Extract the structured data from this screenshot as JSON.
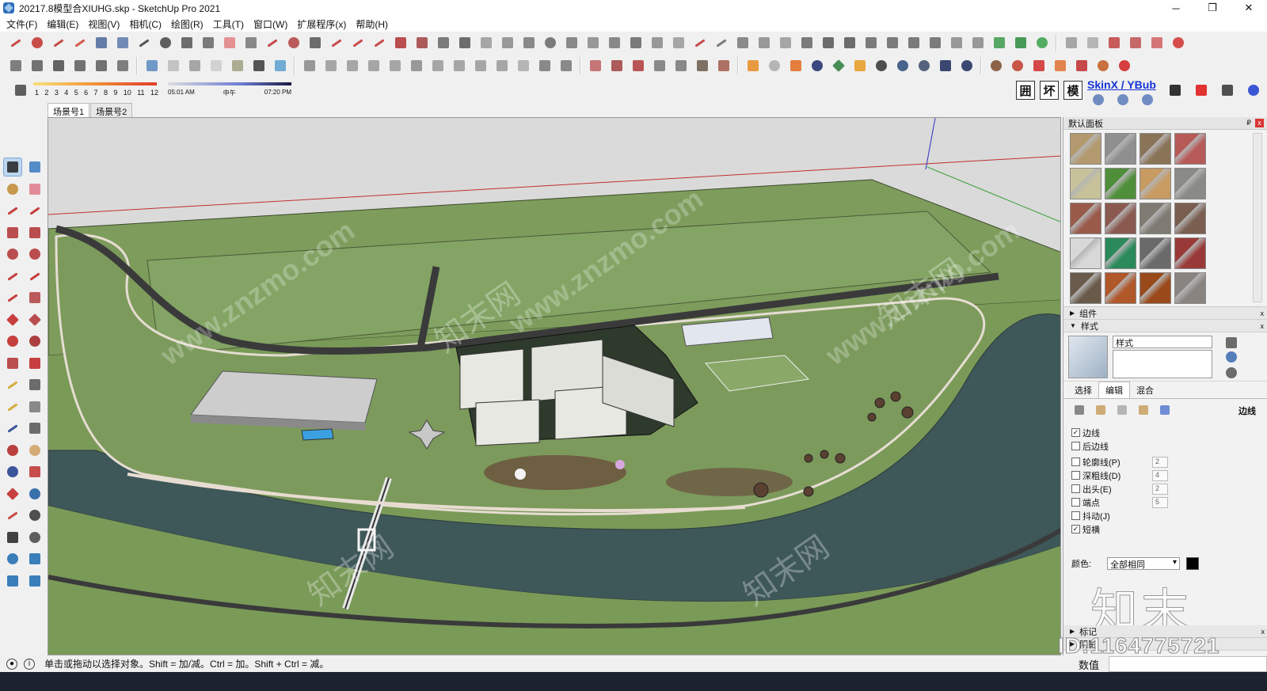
{
  "window": {
    "title": "20217.8模型合XIUHG.skp - SketchUp Pro 2021",
    "minimize": "─",
    "maximize": "❐",
    "close": "✕"
  },
  "menu": [
    "文件(F)",
    "编辑(E)",
    "视图(V)",
    "相机(C)",
    "绘图(R)",
    "工具(T)",
    "窗口(W)",
    "扩展程序(x)",
    "帮助(H)"
  ],
  "shadow_bar": {
    "months": [
      "1",
      "2",
      "3",
      "4",
      "5",
      "6",
      "7",
      "8",
      "9",
      "10",
      "11",
      "12"
    ],
    "time_start": "05:01 AM",
    "time_mid": "中午",
    "time_end": "07:20 PM"
  },
  "toolbar_right": {
    "btn1": "囲",
    "btn2": "坏",
    "btn3": "模",
    "skinx": "SkinX / YBub"
  },
  "scenes": [
    "场景号1",
    "场景号2"
  ],
  "viewport": {
    "watermark": "www.znzmo.com",
    "watermark_cn": "知末网"
  },
  "right_panel": {
    "tray_title": "默认面板",
    "pin": "₽",
    "close": "x",
    "section_components": "组件",
    "section_styles": "样式",
    "style_name": "样式",
    "tabs": [
      "选择",
      "编辑",
      "混合"
    ],
    "edit_label": "边线",
    "edge_options": [
      {
        "label": "边线",
        "checked": true,
        "value": ""
      },
      {
        "label": "后边线",
        "checked": false,
        "value": ""
      },
      {
        "label": "轮廓线(P)",
        "checked": false,
        "value": "2"
      },
      {
        "label": "深粗线(D)",
        "checked": false,
        "value": "4"
      },
      {
        "label": "出头(E)",
        "checked": false,
        "value": "2"
      },
      {
        "label": "端点",
        "checked": false,
        "value": "5"
      },
      {
        "label": "抖动(J)",
        "checked": false,
        "value": ""
      },
      {
        "label": "短横",
        "checked": true,
        "value": ""
      }
    ],
    "color_label": "颜色:",
    "color_value": "全部相同",
    "logo": "知末",
    "section_tags": "标记",
    "section_shadows": "阴影",
    "values_label": "数值"
  },
  "material_swatches": [
    "#b39a6e",
    "#8f8f8f",
    "#8a7458",
    "#b65a58",
    "#c7c29a",
    "#4f8f3a",
    "#c79b62",
    "#8a8a86",
    "#9a5a4a",
    "#8a5a50",
    "#7f7a72",
    "#7a5e50",
    "#d8d8d8",
    "#2a8a5a",
    "#6a6a6a",
    "#9a3a38",
    "#6a5a4a",
    "#b0582a",
    "#9a4a1a",
    "#8a8480",
    "#5a7a3a",
    "#c8b890",
    "#3a7a3a",
    "#6a8a3a"
  ],
  "status": {
    "text": "单击或拖动以选择对象。Shift = 加/减。Ctrl = 加。Shift + Ctrl = 减。",
    "id_watermark": "ID:1164775721"
  },
  "colors": {
    "terrain": "#7c9a5c",
    "river": "#3d5558",
    "road": "#3a3a3a",
    "sky": "#dadada",
    "accent": "#1533d6"
  }
}
